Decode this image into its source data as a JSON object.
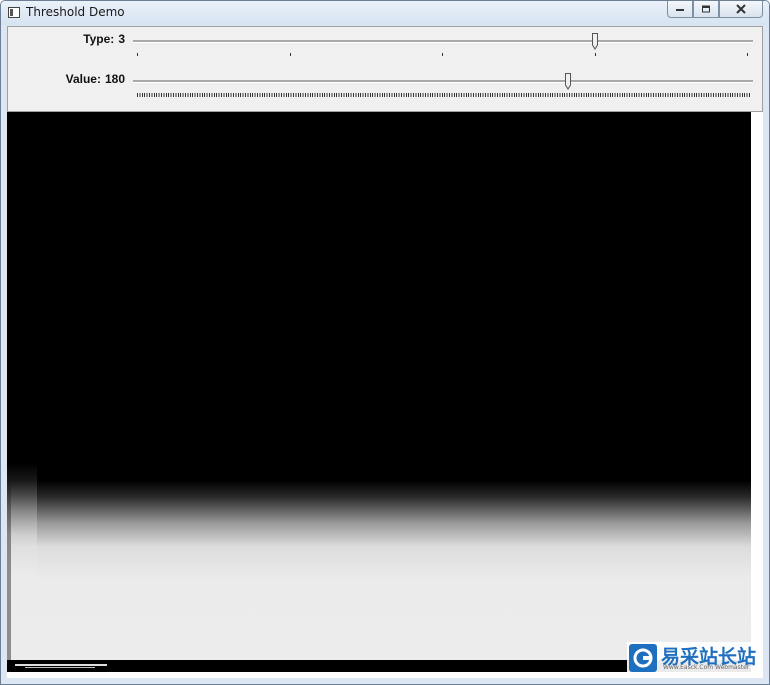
{
  "window": {
    "title": "Threshold Demo",
    "icon": "app-window-icon",
    "buttons": [
      "minimize-icon",
      "restore-icon",
      "close-icon"
    ]
  },
  "trackbars": {
    "type": {
      "label": "Type:",
      "value": 3,
      "value_text": "3",
      "min": 0,
      "max": 4
    },
    "value": {
      "label": "Value:",
      "value": 180,
      "value_text": "180",
      "min": 0,
      "max": 255
    }
  },
  "image": {
    "description_hidden": "",
    "background": "#000000",
    "highlight": "#ececec"
  },
  "watermark": {
    "text": "易采站长站",
    "subtext": "Www.Easck.Com Webmaster",
    "color": "#1f6fc0"
  }
}
